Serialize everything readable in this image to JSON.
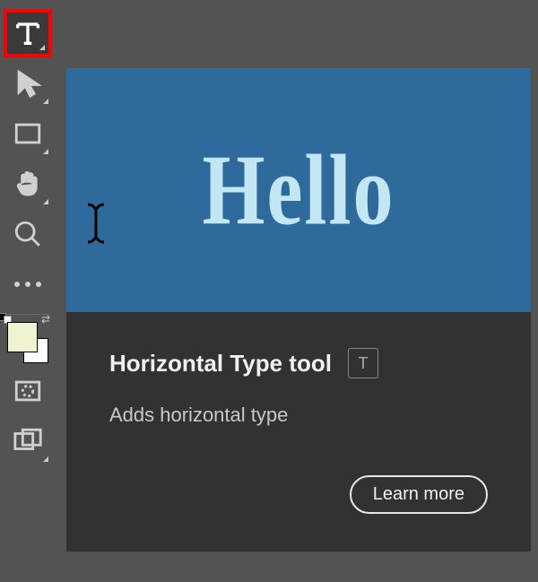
{
  "tooltip": {
    "preview_text": "Hello",
    "title": "Horizontal Type tool",
    "shortcut": "T",
    "description": "Adds horizontal type",
    "learn_more_label": "Learn more"
  },
  "colors": {
    "preview_bg": "#2f6a9c",
    "preview_text": "#c2e6f2",
    "highlight": "#ff0000",
    "panel_bg": "#323232",
    "app_bg": "#535353",
    "foreground_swatch": "#eff3cf",
    "background_swatch": "#ffffff"
  },
  "toolbar": {
    "tools": [
      {
        "name": "type-tool",
        "has_submenu": true,
        "highlighted": true
      },
      {
        "name": "path-selection-tool",
        "has_submenu": true
      },
      {
        "name": "rectangle-tool",
        "has_submenu": true
      },
      {
        "name": "hand-tool",
        "has_submenu": true
      },
      {
        "name": "zoom-tool",
        "has_submenu": false
      },
      {
        "name": "more-tools",
        "has_submenu": false
      },
      {
        "name": "color-swatches",
        "has_submenu": false
      },
      {
        "name": "quick-mask-tool",
        "has_submenu": false
      },
      {
        "name": "screen-mode-tool",
        "has_submenu": true
      }
    ]
  }
}
